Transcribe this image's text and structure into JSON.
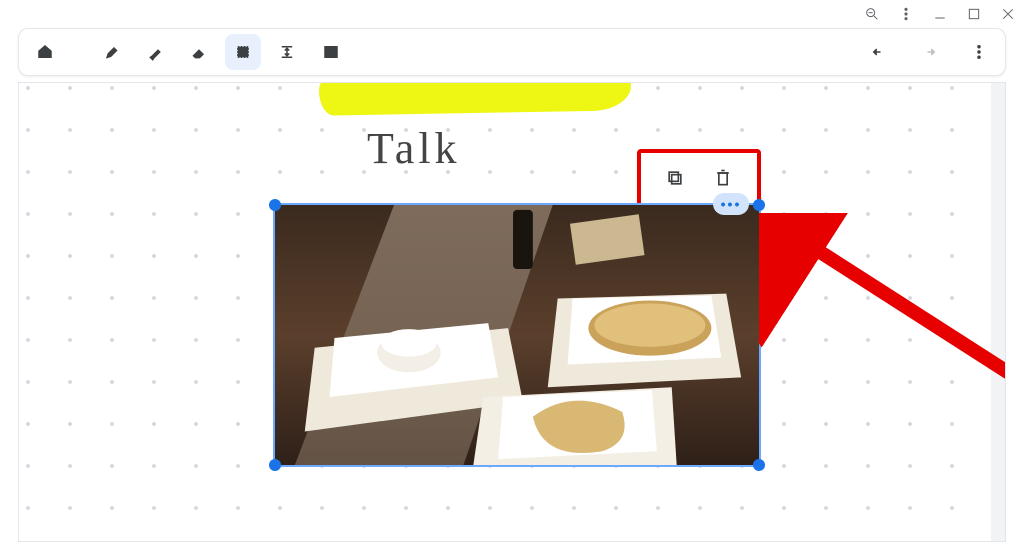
{
  "window_controls": {
    "zoom_out": "zoom-out",
    "kebab": "more",
    "minimize": "minimize",
    "maximize": "maximize",
    "close": "close"
  },
  "toolbar": {
    "home": "home",
    "pen": "pen",
    "highlighter": "highlighter",
    "eraser": "eraser",
    "lasso": "lasso-select",
    "text_resize": "fit-image",
    "insert_image": "insert-image",
    "undo": "undo",
    "redo": "redo",
    "overflow": "more-options",
    "active_tool": "lasso"
  },
  "canvas": {
    "handwriting_text": "Talk",
    "highlight_color": "#eef713",
    "image": {
      "alt": "table-photo"
    },
    "ellipsis_label": "•••",
    "selection_color": "#1a73e8"
  },
  "context_toolbar": {
    "copy": "copy",
    "delete": "delete"
  },
  "annotation": {
    "arrow_color": "#e60000"
  }
}
